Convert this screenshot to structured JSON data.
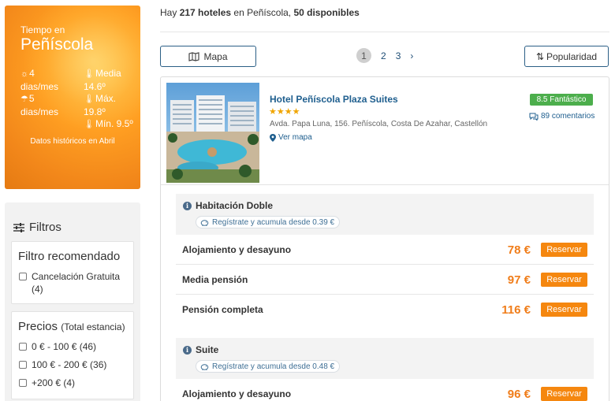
{
  "weather": {
    "title_small": "Tiempo en",
    "title_city": "Peñíscola",
    "sun_value": "4",
    "sun_unit": "dias/mes",
    "rain_value": "5",
    "rain_unit": "dias/mes",
    "temp_avg_label": "Media",
    "temp_avg_value": "14.6º",
    "temp_max_label": "Máx.",
    "temp_max_value": "19.8º",
    "temp_min_label": "Mín. 9.5º",
    "note": "Datos históricos en Abril"
  },
  "filters": {
    "title": "Filtros",
    "recommended": {
      "title": "Filtro recomendado",
      "options": [
        {
          "label": "Cancelación Gratuita",
          "count": "(4)"
        }
      ]
    },
    "prices": {
      "title": "Precios",
      "subtitle": "(Total estancia)",
      "options": [
        {
          "label": "0 € - 100 € (46)"
        },
        {
          "label": "100 € - 200 € (36)"
        },
        {
          "label": "+200 € (4)"
        }
      ]
    }
  },
  "summary": {
    "prefix": "Hay ",
    "count": "217 hoteles",
    "middle": " en Peñíscola, ",
    "available": "50 disponibles"
  },
  "toolbar": {
    "map_label": "Mapa",
    "sort_label": "Popularidad",
    "pages": [
      "1",
      "2",
      "3"
    ],
    "next": "›"
  },
  "hotel": {
    "name": "Hotel Peñíscola Plaza Suites",
    "stars": "★★★★",
    "address": "Avda. Papa Luna, 156. Peñíscola, Costa De Azahar, Castellón",
    "map_link": "Ver mapa",
    "score": "8.5 Fantástico",
    "comments": "89 comentarios",
    "rooms": [
      {
        "title": "Habitación Doble",
        "promo": "Regístrate y acumula desde 0.39 €",
        "rates": [
          {
            "name": "Alojamiento y desayuno",
            "price": "78 €",
            "action": "Reservar"
          },
          {
            "name": "Media pensión",
            "price": "97 €",
            "action": "Reservar"
          },
          {
            "name": "Pensión completa",
            "price": "116 €",
            "action": "Reservar"
          }
        ]
      },
      {
        "title": "Suite",
        "promo": "Regístrate y acumula desde 0.48 €",
        "rates": [
          {
            "name": "Alojamiento y desayuno",
            "price": "96 €",
            "action": "Reservar"
          }
        ]
      }
    ]
  },
  "colors": {
    "accent_orange": "#f5870f",
    "link_blue": "#1e5e8e",
    "score_green": "#4cae4c"
  }
}
